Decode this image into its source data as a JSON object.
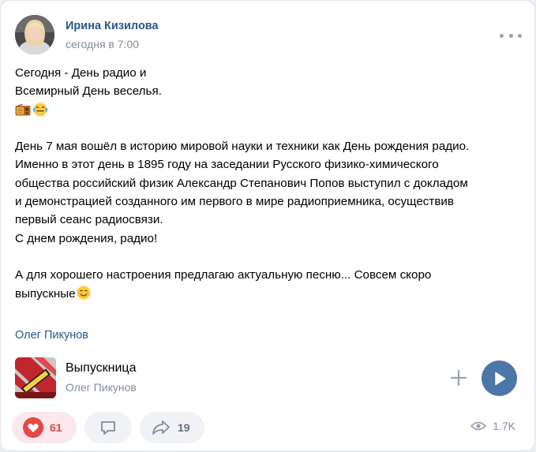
{
  "post": {
    "author": "Ирина Кизилова",
    "time": "сегодня в 7:00",
    "lines": [
      "Сегодня - День радио и",
      "Всемирный День веселья.",
      "День 7 мая вошёл в историю мировой науки и техники как День рождения радио.",
      "Именно в этот день в 1895 году на заседании Русского физико-химического",
      "общества российский физик Александр Степанович Попов выступил с докладом",
      "и демонстрацией созданного им первого в мире радиоприемника, осуществив",
      "первый сеанс радиосвязи.",
      "С днем рождения, радио!",
      "А для хорошего настроения предлагаю актуальную песню... Совсем скоро",
      "выпускные"
    ],
    "icons": {
      "more": "more-horizontal-icon",
      "radio": "radio-emoji",
      "laugh": "tears-of-joy-emoji",
      "smile": "smiling-emoji"
    }
  },
  "repost": {
    "author": "Олег Пикунов"
  },
  "audio": {
    "title": "Выпускница",
    "artist": "Олег Пикунов",
    "accent": "#4a76a8"
  },
  "actions": {
    "likes": "61",
    "shares": "19",
    "views": "1.7K",
    "like_color": "#e64646"
  }
}
